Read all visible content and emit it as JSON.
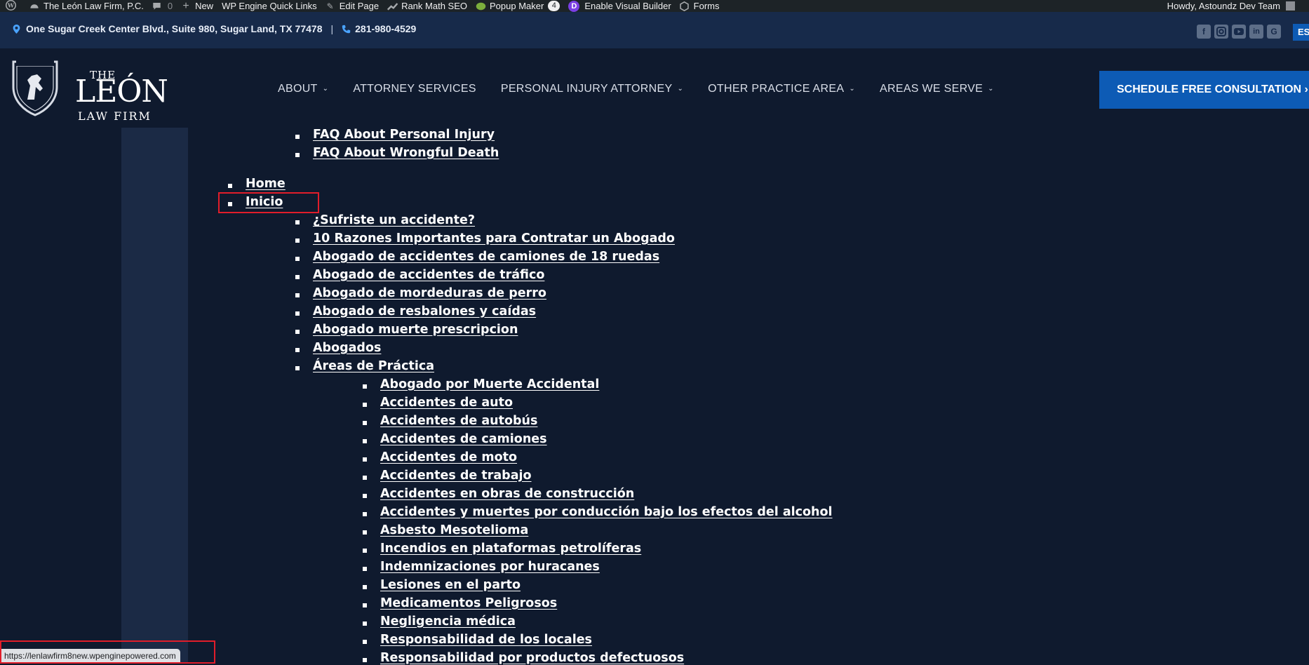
{
  "admin_bar": {
    "site_name": "The León Law Firm, P.C.",
    "comments_count": "0",
    "new_label": "New",
    "wp_engine_label": "WP Engine Quick Links",
    "edit_page_label": "Edit Page",
    "rank_math_label": "Rank Math SEO",
    "popup_maker_label": "Popup Maker",
    "popup_maker_badge": "4",
    "visual_builder_label": "Enable Visual Builder",
    "forms_label": "Forms",
    "howdy_label": "Howdy, Astoundz Dev Team"
  },
  "top_bar": {
    "address": "One Sugar Creek Center Blvd., Suite 980, Sugar Land, TX 77478",
    "separator": "|",
    "phone": "281-980-4529",
    "social_icons": [
      "facebook-icon",
      "instagram-icon",
      "youtube-icon",
      "linkedin-icon",
      "google-icon"
    ],
    "language": "ES"
  },
  "header": {
    "logo_the": "THE",
    "logo_leon": "LEÓN",
    "logo_firm": "LAW FIRM",
    "nav": [
      {
        "label": "ABOUT",
        "has_dropdown": true
      },
      {
        "label": "ATTORNEY SERVICES",
        "has_dropdown": false
      },
      {
        "label": "PERSONAL INJURY ATTORNEY",
        "has_dropdown": true
      },
      {
        "label": "OTHER PRACTICE AREA",
        "has_dropdown": true
      },
      {
        "label": "AREAS WE SERVE",
        "has_dropdown": true
      }
    ],
    "cta_label": "SCHEDULE FREE CONSULTATION ›"
  },
  "sitemap": {
    "faq_personal_injury": "FAQ About Personal Injury",
    "faq_wrongful_death": "FAQ About Wrongful Death",
    "home": "Home",
    "inicio": "Inicio",
    "spanish_pages": [
      "¿Sufriste un accidente?",
      "10 Razones Importantes para Contratar un Abogado",
      "Abogado de accidentes de camiones de 18 ruedas",
      "Abogado de accidentes de tráfico",
      "Abogado de mordeduras de perro",
      "Abogado de resbalones y caídas",
      "Abogado muerte prescripcion",
      "Abogados",
      "Áreas de Práctica"
    ],
    "practice_areas": [
      "Abogado por Muerte Accidental",
      "Accidentes de auto",
      "Accidentes de autobús",
      "Accidentes de camiones",
      "Accidentes de moto",
      "Accidentes de trabajo",
      "Accidentes en obras de construcción",
      "Accidentes y muertes por conducción bajo los efectos del alcohol",
      "Asbesto Mesotelioma",
      "Incendios en plataformas petrolíferas",
      "Indemnizaciones por huracanes",
      "Lesiones en el parto",
      "Medicamentos Peligrosos",
      "Negligencia médica",
      "Responsabilidad de los locales",
      "Responsabilidad por productos defectuosos"
    ]
  },
  "status_bar": {
    "url": "https://lenlawfirm8new.wpenginepowered.com"
  },
  "colors": {
    "admin_bar": "#1d2327",
    "top_bar": "#172a4a",
    "page_bg": "#0f1a2e",
    "accent_blue": "#0d5bb5",
    "highlight_red": "#e11d2a"
  }
}
